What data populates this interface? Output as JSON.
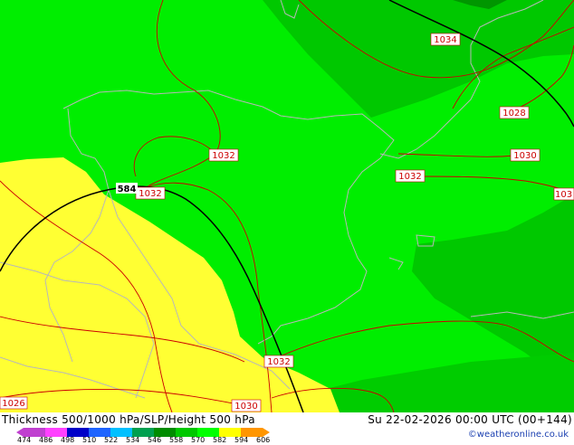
{
  "title": "Thickness 500/1000 hPa/SLP/Height 500 hPa",
  "datetime": "Su 22-02-2026 00:00 UTC (00+144)",
  "credit": "©weatheronline.co.uk",
  "isobar_labels": [
    "1034",
    "1028",
    "1030",
    "1032",
    "1032",
    "1032",
    "1032",
    "1032",
    "1030",
    "1026"
  ],
  "isobar_label_partial": "103",
  "height_label": "584",
  "colorbar": {
    "ticks": [
      "474",
      "486",
      "498",
      "510",
      "522",
      "534",
      "546",
      "558",
      "570",
      "582",
      "594",
      "606"
    ],
    "colors": [
      "#c040d0",
      "#ff40ff",
      "#0000c8",
      "#1e64ff",
      "#00c0ff",
      "#00a050",
      "#008c00",
      "#00c800",
      "#00ff00",
      "#ffff00",
      "#ff9600"
    ]
  },
  "colors": {
    "yellow_band": "#ffff33",
    "bright_green": "#00ee00",
    "mid_green": "#00cc00",
    "dark_green": "#009900",
    "isobar": "#cc0000",
    "height_contour": "#000000",
    "coastline": "#b0b0b0"
  }
}
